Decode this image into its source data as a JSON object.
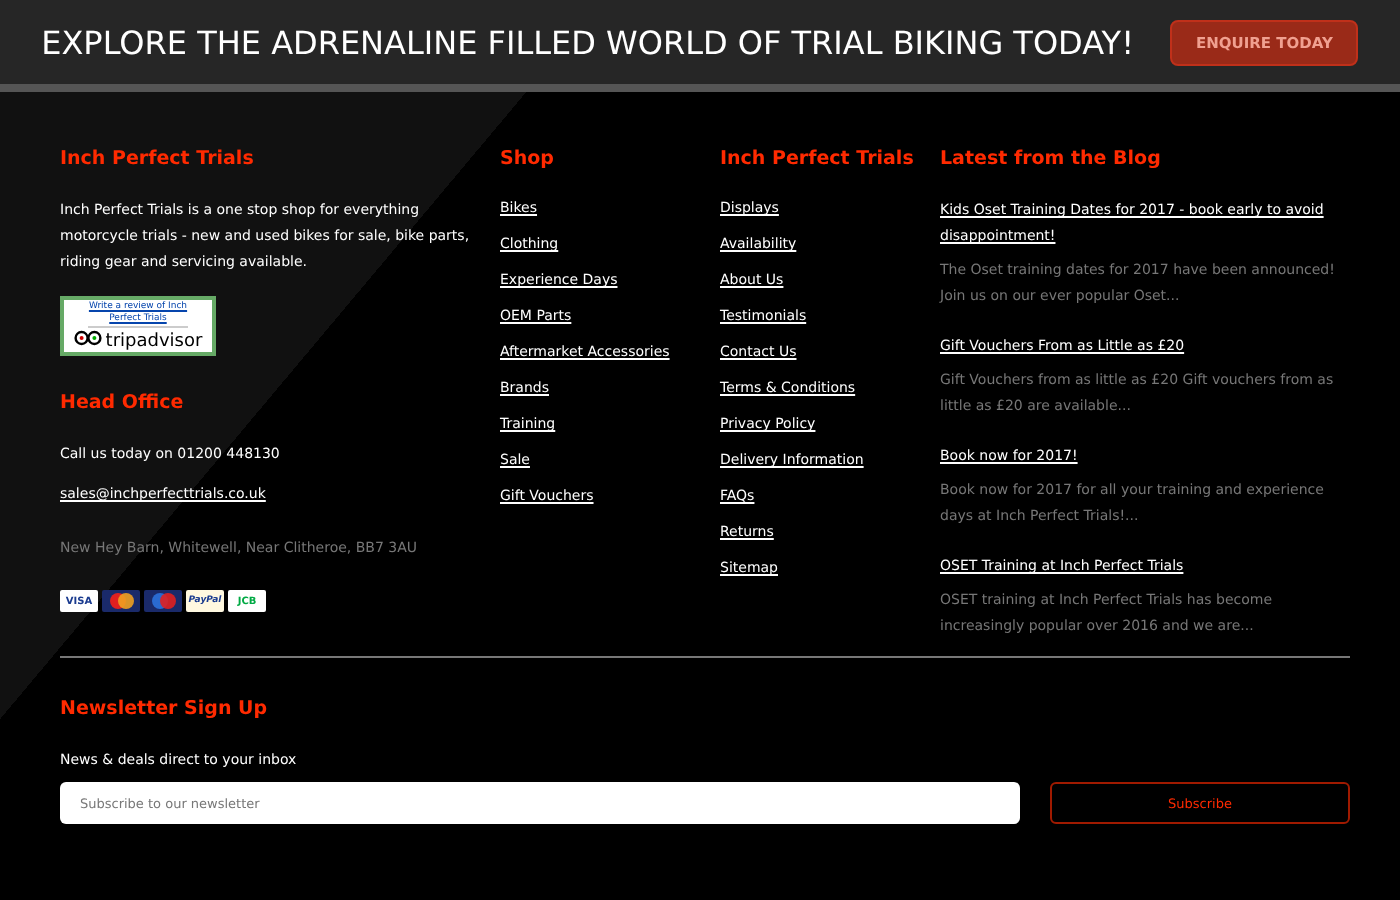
{
  "banner": {
    "text": "EXPLORE THE ADRENALINE FILLED WORLD OF TRIAL BIKING TODAY!",
    "button": "ENQUIRE TODAY"
  },
  "about": {
    "heading": "Inch Perfect Trials",
    "text": "Inch Perfect Trials is a one stop shop for everything motorcycle trials - new and used bikes for sale, bike parts, riding gear and servicing available.",
    "review_link": "Write a review of Inch Perfect Trials",
    "review_logo": "tripadvisor"
  },
  "head_office": {
    "heading": "Head Office",
    "phone": "Call us today on 01200 448130",
    "email": "sales@inchperfecttrials.co.uk",
    "address": "New Hey Barn, Whitewell, Near Clitheroe, BB7 3AU"
  },
  "payment_cards": [
    {
      "kind": "visa",
      "label": "VISA"
    },
    {
      "kind": "mastercard"
    },
    {
      "kind": "maestro"
    },
    {
      "kind": "paypal",
      "label": "PayPal"
    },
    {
      "kind": "jcb",
      "label": "JCB"
    }
  ],
  "link_columns": [
    {
      "heading": "Shop",
      "links": [
        "Bikes",
        "Clothing",
        "Experience Days",
        "OEM Parts",
        "Aftermarket Accessories",
        "Brands",
        "Training",
        "Sale",
        "Gift Vouchers"
      ]
    },
    {
      "heading": "Inch Perfect Trials",
      "links": [
        "Displays",
        "Availability",
        "About Us",
        "Testimonials",
        "Contact Us",
        "Terms & Conditions",
        "Privacy Policy",
        "Delivery Information",
        "FAQs",
        "Returns",
        "Sitemap"
      ]
    }
  ],
  "blog": {
    "heading": "Latest from the Blog",
    "posts": [
      {
        "title": "Kids Oset Training Dates for 2017 - book early to avoid disappointment!",
        "excerpt": "The Oset training dates for 2017 have been announced! Join us on our ever popular Oset..."
      },
      {
        "title": "Gift Vouchers From as Little as £20",
        "excerpt": "Gift Vouchers from as little as £20 Gift vouchers from as little as £20 are available..."
      },
      {
        "title": "Book now for 2017!",
        "excerpt": "Book now for 2017 for all your training and experience days at Inch Perfect Trials!..."
      },
      {
        "title": "OSET Training at Inch Perfect Trials",
        "excerpt": "OSET training at Inch Perfect Trials has become increasingly popular over 2016 and we are..."
      }
    ]
  },
  "newsletter": {
    "heading": "Newsletter Sign Up",
    "text": "News & deals direct to your inbox",
    "placeholder": "Subscribe to our newsletter",
    "button": "Subscribe"
  }
}
